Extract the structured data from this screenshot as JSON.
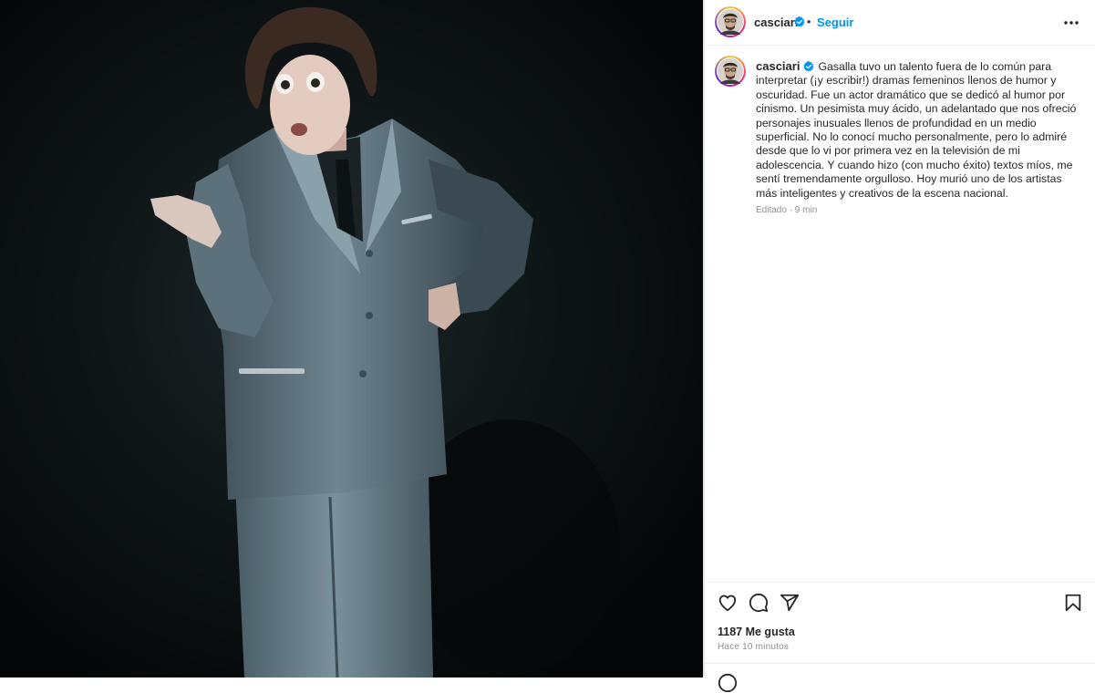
{
  "post": {
    "username": "casciari",
    "follow_label": "Seguir",
    "separator": "•",
    "caption": "Gasalla tuvo un talento fuera de lo común para interpretar (¡y escribir!) dramas femeninos llenos de humor y oscuridad. Fue un actor dramático que se dedicó al humor por cinismo. Un pesimista muy ácido, un adelantado que nos ofreció personajes inusuales llenos de profundidad en un medio superficial. No lo conocí mucho personalmente, pero lo admiré desde que lo vi por primera vez en la televisión de mi adolescencia. Y cuando hizo (con mucho éxito) textos míos, me sentí tremendamente orgulloso. Hoy murió uno de los artistas más inteligentes y creativos de la escena nacional.",
    "edited_meta": "Editado · 9 min",
    "likes": "1187 Me gusta",
    "timestamp": "Hace 10 minutos"
  },
  "icons": {
    "verified": "verified-badge-icon",
    "more": "more-options-icon",
    "like": "heart-icon",
    "comment": "comment-icon",
    "share": "share-icon",
    "save": "bookmark-icon"
  },
  "colors": {
    "accent": "#0095f6",
    "text": "#262626",
    "muted": "#8e8e8e",
    "photo_background": "#05080a",
    "suit": "#5f7480"
  }
}
